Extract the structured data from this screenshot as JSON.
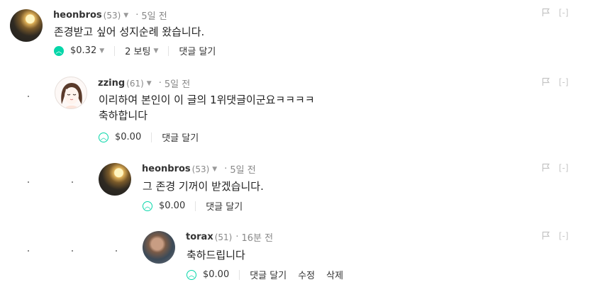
{
  "comments": [
    {
      "author": "heonbros",
      "reputation": "(53)",
      "time": "5일 전",
      "body": [
        "존경받고 싶어 성지순례 왔습니다."
      ],
      "payout": "$0.32",
      "votes": "2 보팅",
      "reply_label": "댓글 달기",
      "avatar": "heonbros-avatar",
      "voted": true
    },
    {
      "author": "zzing",
      "reputation": "(61)",
      "time": "5일 전",
      "body": [
        "이리하여 본인이 이 글의 1위댓글이군요ㅋㅋㅋㅋ",
        "축하합니다"
      ],
      "payout": "$0.00",
      "reply_label": "댓글 달기",
      "avatar": "zzing-avatar",
      "voted": false
    },
    {
      "author": "heonbros",
      "reputation": "(53)",
      "time": "5일 전",
      "body": [
        "그 존경 기꺼이 받겠습니다."
      ],
      "payout": "$0.00",
      "reply_label": "댓글 달기",
      "avatar": "heonbros-avatar",
      "voted": false
    },
    {
      "author": "torax",
      "reputation": "(51)",
      "time": "16분 전",
      "body": [
        "축하드립니다"
      ],
      "payout": "$0.00",
      "reply_label": "댓글 달기",
      "edit_label": "수정",
      "delete_label": "삭제",
      "avatar": "torax-avatar",
      "voted": false
    }
  ],
  "icons": {
    "flag": "flag-icon",
    "collapse": "[-]",
    "caret": "▼",
    "upvote": "chevron-up-icon"
  },
  "colors": {
    "accent": "#06d6a9",
    "muted": "#999999"
  }
}
